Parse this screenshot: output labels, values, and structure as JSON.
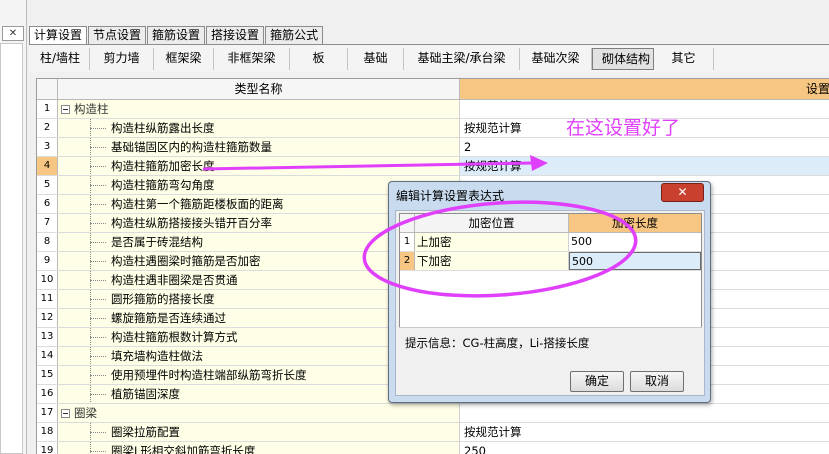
{
  "left_panel": {
    "close_glyph": "✕"
  },
  "tabs": [
    "计算设置",
    "节点设置",
    "箍筋设置",
    "搭接设置",
    "箍筋公式"
  ],
  "subtabs": [
    "柱/墙柱",
    "剪力墙",
    "框架梁",
    "非框架梁",
    "板",
    "基础",
    "基础主梁/承台梁",
    "基础次梁",
    "砌体结构",
    "其它"
  ],
  "grid": {
    "header_name": "类型名称",
    "header_value": "设置",
    "rows": [
      {
        "num": "1",
        "name": "构造柱",
        "value": ""
      },
      {
        "num": "2",
        "name": "构造柱纵筋露出长度",
        "value": "按规范计算"
      },
      {
        "num": "3",
        "name": "基础锚固区内的构造柱箍筋数量",
        "value": "2"
      },
      {
        "num": "4",
        "name": "构造柱箍筋加密长度",
        "value": "按规范计算"
      },
      {
        "num": "5",
        "name": "构造柱箍筋弯勾角度",
        "value": ""
      },
      {
        "num": "6",
        "name": "构造柱第一个箍筋距楼板面的距离",
        "value": ""
      },
      {
        "num": "7",
        "name": "构造柱纵筋搭接接头错开百分率",
        "value": ""
      },
      {
        "num": "8",
        "name": "是否属于砖混结构",
        "value": ""
      },
      {
        "num": "9",
        "name": "构造柱遇圈梁时箍筋是否加密",
        "value": ""
      },
      {
        "num": "10",
        "name": "构造柱遇非圈梁是否贯通",
        "value": ""
      },
      {
        "num": "11",
        "name": "圆形箍筋的搭接长度",
        "value": ""
      },
      {
        "num": "12",
        "name": "螺旋箍筋是否连续通过",
        "value": ""
      },
      {
        "num": "13",
        "name": "构造柱箍筋根数计算方式",
        "value": ""
      },
      {
        "num": "14",
        "name": "填充墙构造柱做法",
        "value": ""
      },
      {
        "num": "15",
        "name": "使用预埋件时构造柱端部纵筋弯折长度",
        "value": ""
      },
      {
        "num": "16",
        "name": "植筋锚固深度",
        "value": ""
      },
      {
        "num": "17",
        "name": "圈梁",
        "value": ""
      },
      {
        "num": "18",
        "name": "圈梁拉筋配置",
        "value": "按规范计算"
      },
      {
        "num": "19",
        "name": "圈梁L形相交斜加筋弯折长度",
        "value": "250"
      }
    ]
  },
  "annotation": {
    "text": "在这设置好了"
  },
  "dialog": {
    "title": "编辑计算设置表达式",
    "close_glyph": "✕",
    "col1": "加密位置",
    "col2": "加密长度",
    "rows": [
      {
        "num": "1",
        "position": "上加密",
        "length": "500"
      },
      {
        "num": "2",
        "position": "下加密",
        "length": "500"
      }
    ],
    "hint": "提示信息：CG-柱高度，Li-搭接长度",
    "ok_label": "确定",
    "cancel_label": "取消"
  },
  "colors": {
    "accent": "#f8c683",
    "selection": "#dcecf9",
    "annotation": "#e040fb"
  }
}
